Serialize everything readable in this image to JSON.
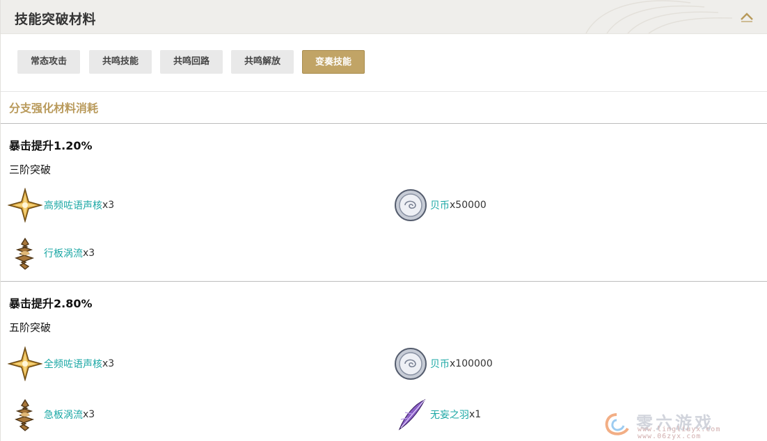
{
  "header": {
    "title": "技能突破材料"
  },
  "tabs": [
    {
      "label": "常态攻击",
      "active": false
    },
    {
      "label": "共鸣技能",
      "active": false
    },
    {
      "label": "共鸣回路",
      "active": false
    },
    {
      "label": "共鸣解放",
      "active": false
    },
    {
      "label": "变奏技能",
      "active": true
    }
  ],
  "section": {
    "title": "分支强化材料消耗"
  },
  "blocks": [
    {
      "title": "暴击提升1.20%",
      "stage": "三阶突破",
      "materials": [
        {
          "icon": "golden-shuriken-icon",
          "name": "高频咗语声核",
          "qty": "x3"
        },
        {
          "icon": "shell-coin-icon",
          "name": "贝币",
          "qty": "x50000"
        },
        {
          "icon": "bronze-vortex-icon",
          "name": "行板涡流",
          "qty": "x3"
        }
      ]
    },
    {
      "title": "暴击提升2.80%",
      "stage": "五阶突破",
      "materials": [
        {
          "icon": "golden-shuriken-icon",
          "name": "全频咗语声核",
          "qty": "x3"
        },
        {
          "icon": "shell-coin-icon",
          "name": "贝币",
          "qty": "x100000"
        },
        {
          "icon": "bronze-vortex-icon",
          "name": "急板涡流",
          "qty": "x3"
        },
        {
          "icon": "purple-feather-icon",
          "name": "无妄之羽",
          "qty": "x1"
        }
      ]
    }
  ],
  "watermark": {
    "text": "零六游戏",
    "url1": "www.lingliuyx.com",
    "url2": "www.06zyx.com"
  },
  "colors": {
    "accent": "#c1a466",
    "link": "#1aa7a4",
    "section": "#b99a5b"
  }
}
